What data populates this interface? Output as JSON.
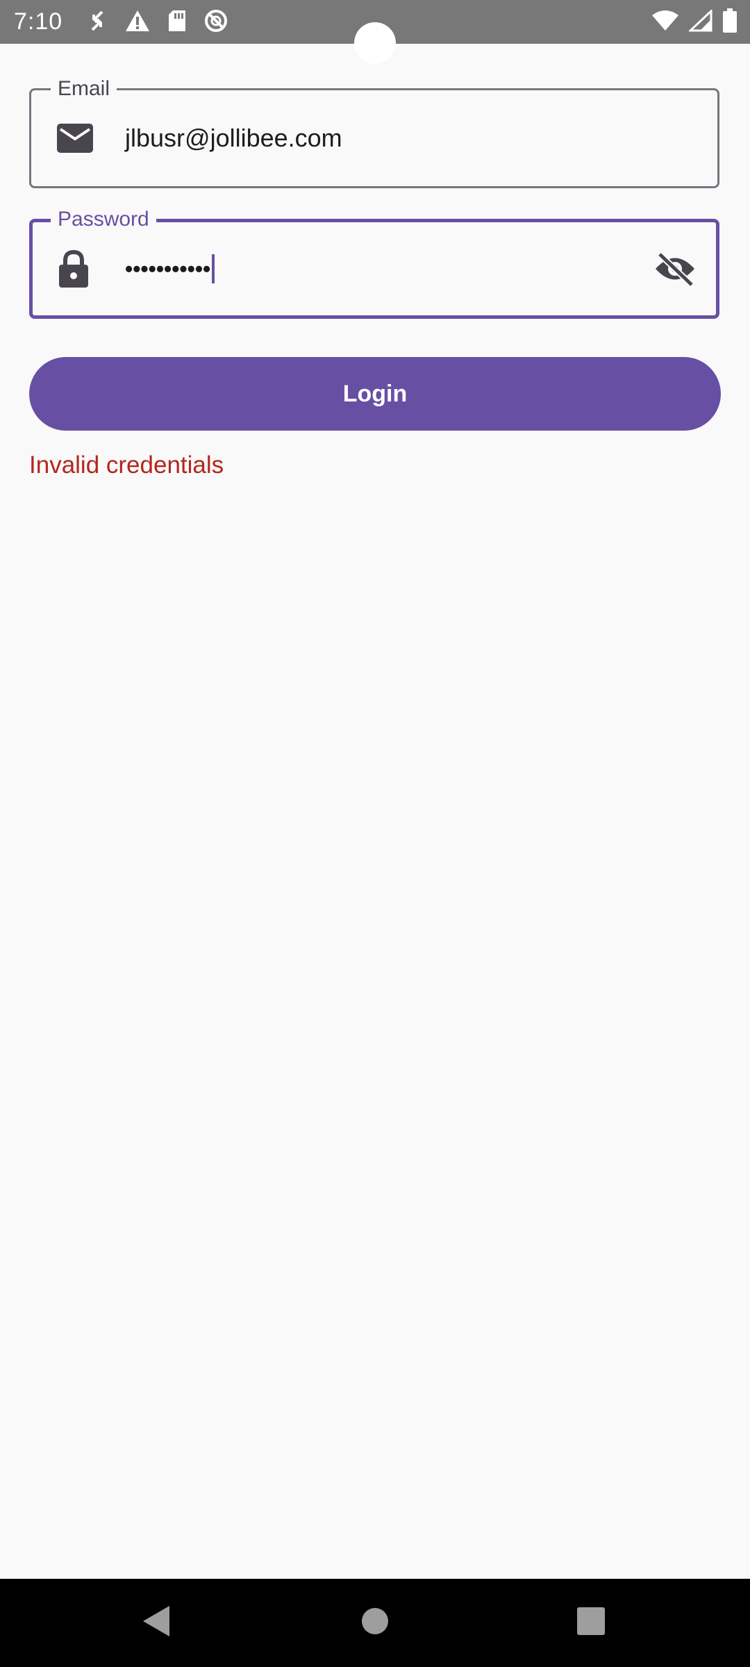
{
  "status_bar": {
    "time": "7:10",
    "left_icons": [
      "screen-rotate-icon",
      "warning-icon",
      "sd-card-icon",
      "do-not-disturb-icon"
    ],
    "right_icons": [
      "wifi-icon",
      "cellular-signal-icon",
      "battery-icon"
    ]
  },
  "form": {
    "email": {
      "label": "Email",
      "value": "jlbusr@jollibee.com",
      "icon": "mail-icon"
    },
    "password": {
      "label": "Password",
      "value": "•••••••••••",
      "icon": "lock-icon",
      "toggle_icon": "visibility-off-icon"
    },
    "login_label": "Login",
    "error_message": "Invalid credentials"
  },
  "colors": {
    "primary": "#6750a4",
    "error": "#b3261e",
    "outline": "#79747e",
    "background": "#f9f9f9",
    "status_bar": "#787878"
  },
  "nav_bar": {
    "buttons": [
      "back-icon",
      "home-icon",
      "recents-icon"
    ]
  }
}
